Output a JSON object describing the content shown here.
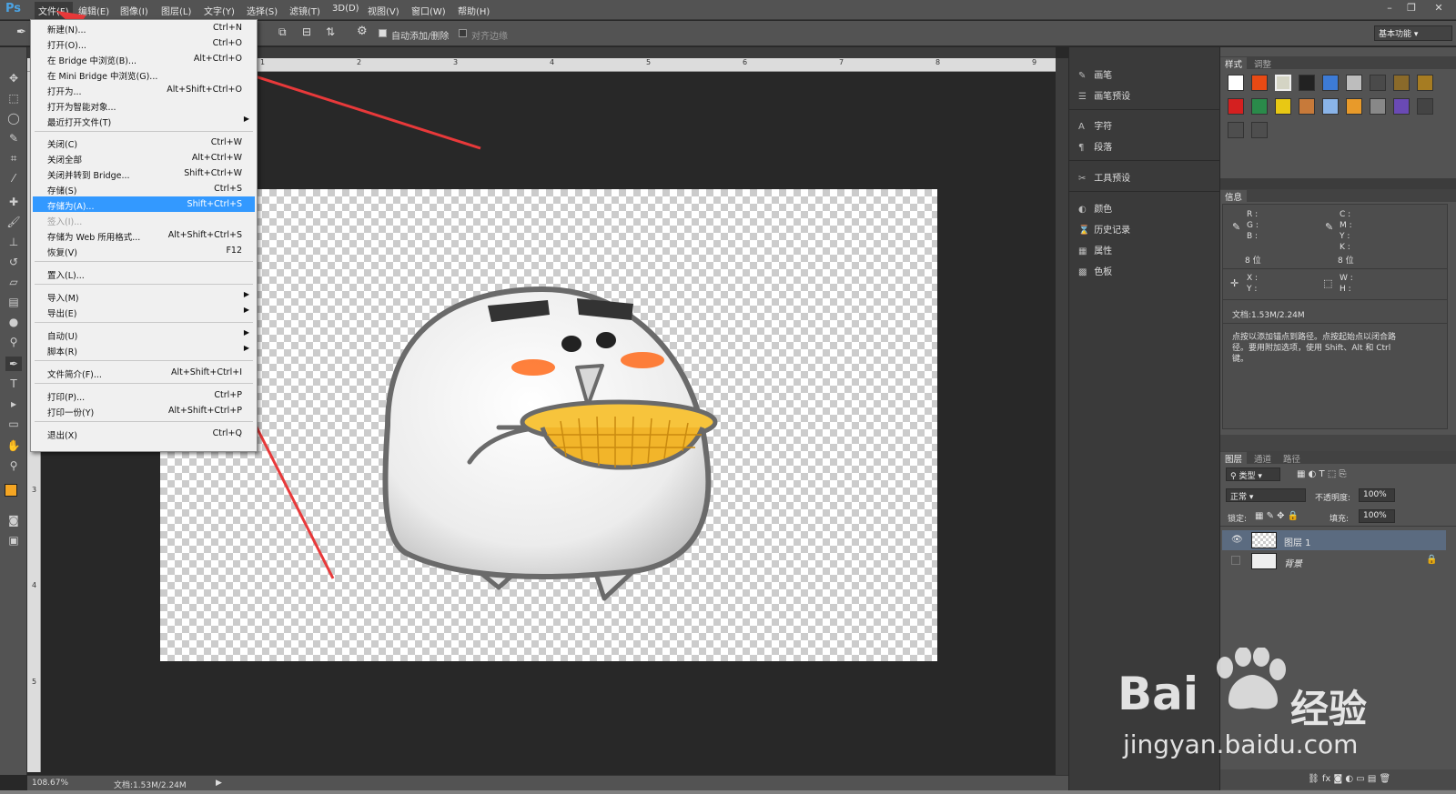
{
  "app": {
    "logo": "Ps"
  },
  "menubar": [
    "文件(F)",
    "编辑(E)",
    "图像(I)",
    "图层(L)",
    "文字(Y)",
    "选择(S)",
    "滤镜(T)",
    "3D(D)",
    "视图(V)",
    "窗口(W)",
    "帮助(H)"
  ],
  "options": {
    "auto_add_delete": "自动添加/删除",
    "align_edges": "对齐边缘",
    "workspace": "基本功能"
  },
  "file_menu": [
    {
      "label": "新建(N)...",
      "shortcut": "Ctrl+N"
    },
    {
      "label": "打开(O)...",
      "shortcut": "Ctrl+O"
    },
    {
      "label": "在 Bridge 中浏览(B)...",
      "shortcut": "Alt+Ctrl+O"
    },
    {
      "label": "在 Mini Bridge 中浏览(G)...",
      "shortcut": ""
    },
    {
      "label": "打开为...",
      "shortcut": "Alt+Shift+Ctrl+O"
    },
    {
      "label": "打开为智能对象...",
      "shortcut": ""
    },
    {
      "label": "最近打开文件(T)",
      "shortcut": ""
    },
    {
      "label": "关闭(C)",
      "shortcut": "Ctrl+W"
    },
    {
      "label": "关闭全部",
      "shortcut": "Alt+Ctrl+W"
    },
    {
      "label": "关闭并转到 Bridge...",
      "shortcut": "Shift+Ctrl+W"
    },
    {
      "label": "存储(S)",
      "shortcut": "Ctrl+S"
    },
    {
      "label": "存储为(A)...",
      "shortcut": "Shift+Ctrl+S"
    },
    {
      "label": "签入(I)...",
      "shortcut": ""
    },
    {
      "label": "存储为 Web 所用格式...",
      "shortcut": "Alt+Shift+Ctrl+S"
    },
    {
      "label": "恢复(V)",
      "shortcut": "F12"
    },
    {
      "label": "置入(L)...",
      "shortcut": ""
    },
    {
      "label": "导入(M)",
      "shortcut": ""
    },
    {
      "label": "导出(E)",
      "shortcut": ""
    },
    {
      "label": "自动(U)",
      "shortcut": ""
    },
    {
      "label": "脚本(R)",
      "shortcut": ""
    },
    {
      "label": "文件简介(F)...",
      "shortcut": "Alt+Shift+Ctrl+I"
    },
    {
      "label": "打印(P)...",
      "shortcut": "Ctrl+P"
    },
    {
      "label": "打印一份(Y)",
      "shortcut": "Alt+Shift+Ctrl+P"
    },
    {
      "label": "退出(X)",
      "shortcut": "Ctrl+Q"
    }
  ],
  "rulers": {
    "top": [
      "1",
      "2",
      "3",
      "4",
      "5",
      "6",
      "7",
      "8",
      "9"
    ],
    "left": [
      "3",
      "4",
      "5"
    ]
  },
  "dock": {
    "brush": "画笔",
    "brush_presets": "画笔预设",
    "character": "字符",
    "paragraph": "段落",
    "tool_presets": "工具预设",
    "color": "颜色",
    "history": "历史记录",
    "properties": "属性",
    "swatches": "色板"
  },
  "styles_panel": {
    "tab_styles": "样式",
    "tab_adjust": "调整"
  },
  "info_panel": {
    "tab": "信息",
    "rgb": [
      "R :",
      "G :",
      "B :"
    ],
    "cmyk": [
      "C :",
      "M :",
      "Y :",
      "K :"
    ],
    "bits_left": "8 位",
    "bits_right": "8 位",
    "xy": [
      "X :",
      "Y :"
    ],
    "wh": [
      "W :",
      "H :"
    ],
    "doc": "文档:1.53M/2.24M",
    "hint": "点按以添加锚点到路径。点按起始点以闭合路径。要用附加选项，使用 Shift、Alt 和 Ctrl 键。"
  },
  "layers_panel": {
    "tabs": [
      "图层",
      "通道",
      "路径"
    ],
    "filter": "类型",
    "blend": "正常",
    "opacity_label": "不透明度:",
    "opacity": "100%",
    "lock_label": "锁定:",
    "fill_label": "填充:",
    "fill": "100%",
    "layers": [
      {
        "name": "图层 1"
      },
      {
        "name": "背景"
      }
    ]
  },
  "status": {
    "zoom": "108.67%",
    "doc": "文档:1.53M/2.24M"
  },
  "watermark": {
    "brand": "Bai",
    "brand_cn": "经验",
    "url": "jingyan.baidu.com"
  },
  "colors": {
    "accent": "#3399ff",
    "annotation": "#e8393a",
    "foreground": "#f5a623"
  }
}
